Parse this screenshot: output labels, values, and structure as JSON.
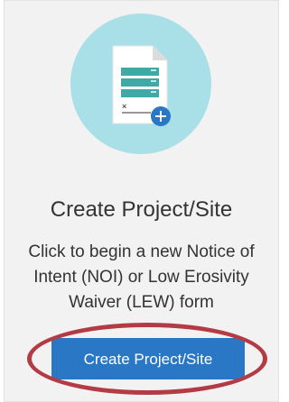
{
  "card": {
    "title": "Create Project/Site",
    "description": "Click to begin a new Notice of Intent (NOI) or Low Erosivity Waiver (LEW) form",
    "button_label": "Create Project/Site",
    "icon": "document-add-icon"
  },
  "colors": {
    "circle": "#a9dfe7",
    "button": "#2a77c5",
    "highlight": "#b23b44",
    "doc_band": "#3fa9a8"
  }
}
